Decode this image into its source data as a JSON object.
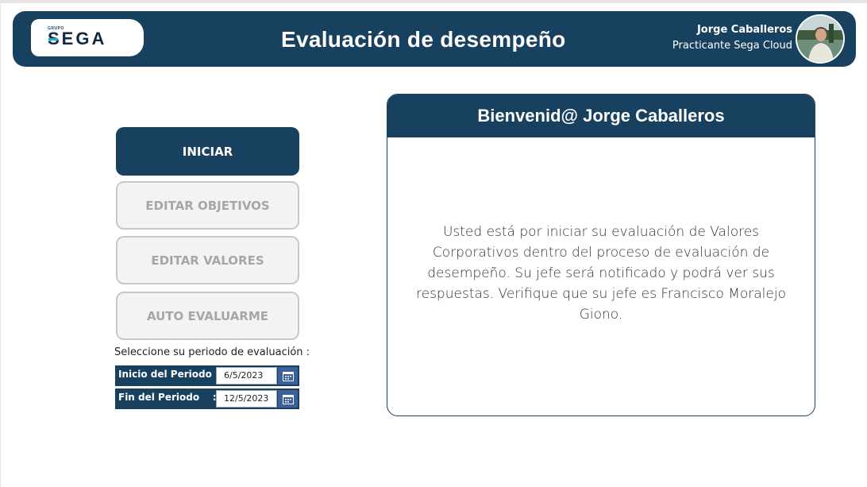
{
  "header": {
    "logo_small": "GRUPO",
    "logo_text": "SEGA",
    "title": "Evaluación de desempeño",
    "user_name": "Jorge Caballeros",
    "user_role": "Practicante Sega Cloud"
  },
  "actions": {
    "start": "INICIAR",
    "edit_objectives": "EDITAR OBJETIVOS",
    "edit_values": "EDITAR VALORES",
    "self_evaluate": "AUTO EVALUARME"
  },
  "period": {
    "prompt": "Seleccione su periodo de evaluación :",
    "start_label": "Inicio del Periodo :",
    "start_value": "6/5/2023",
    "end_label": "Fin del Periodo    :",
    "end_value": "12/5/2023"
  },
  "welcome": {
    "title": "Bienvenid@ Jorge Caballeros",
    "message": "Usted está por iniciar su evaluación de Valores Corporativos dentro del proceso de evaluación de desempeño. Su jefe será notificado y podrá ver sus respuestas. Verifique que su jefe es Francisco Moralejo Giono."
  },
  "colors": {
    "primary": "#18405f",
    "disabled_bg": "#f3f3f3",
    "disabled_text": "#a6a6a6",
    "calendar_button": "#3d5f9c",
    "logo_accent": "#19b3c7"
  },
  "icons": [
    "calendar-icon",
    "avatar"
  ]
}
